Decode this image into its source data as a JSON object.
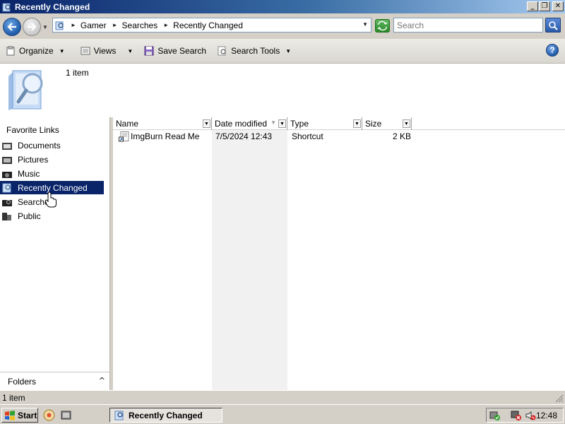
{
  "window": {
    "title": "Recently Changed",
    "buttons": {
      "minimize": "_",
      "restore": "❐",
      "close": "✕"
    }
  },
  "address": {
    "crumbs": [
      "Gamer",
      "Searches",
      "Recently Changed"
    ],
    "search_placeholder": "Search"
  },
  "toolbar": {
    "organize": "Organize",
    "views": "Views",
    "save_search": "Save Search",
    "search_tools": "Search Tools",
    "help": "?"
  },
  "header": {
    "item_count": "1 item"
  },
  "sidebar": {
    "heading": "Favorite Links",
    "items": [
      {
        "label": "Documents"
      },
      {
        "label": "Pictures"
      },
      {
        "label": "Music"
      },
      {
        "label": "Recently Changed",
        "selected": true
      },
      {
        "label": "Searches"
      },
      {
        "label": "Public"
      }
    ],
    "folders_label": "Folders",
    "folders_chevron": "^"
  },
  "filelist": {
    "columns": [
      "Name",
      "Date modified",
      "Type",
      "Size"
    ],
    "rows": [
      {
        "name": "ImgBurn Read Me",
        "date": "7/5/2024 12:43",
        "type": "Shortcut",
        "size": "2 KB"
      }
    ]
  },
  "statusbar": {
    "text": "1 item"
  },
  "taskbar": {
    "start": "Start",
    "task": "Recently Changed",
    "clock": "12:48"
  },
  "colors": {
    "selection": "#0a246a",
    "title_start": "#0a246a",
    "title_end": "#a6caf0"
  }
}
